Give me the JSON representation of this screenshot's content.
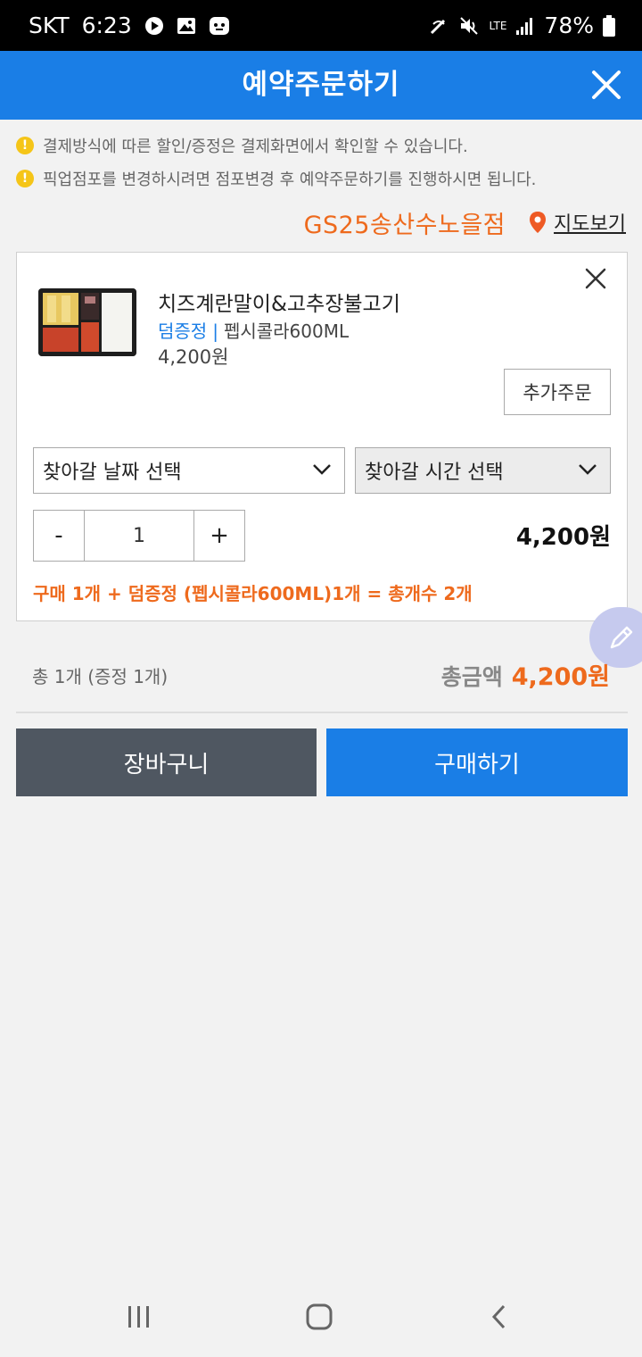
{
  "status_bar": {
    "carrier": "SKT",
    "time": "6:23",
    "network": "LTE",
    "battery": "78%",
    "icons": [
      "play-icon",
      "gallery-icon",
      "app-icon",
      "nfc-icon",
      "mute-icon",
      "signal-icon",
      "battery-icon"
    ]
  },
  "header": {
    "title": "예약주문하기",
    "close_icon": "close-icon"
  },
  "notices": [
    {
      "icon": "!",
      "text": "결제방식에 따른 할인/증정은 결제화면에서 확인할 수 있습니다."
    },
    {
      "icon": "!",
      "text": "픽업점포를 변경하시려면 점포변경 후 예약주문하기를 진행하시면 됩니다."
    }
  ],
  "store": {
    "name": "GS25송산수노을점",
    "map_link": "지도보기"
  },
  "item": {
    "name": "치즈계란말이&고추장불고기",
    "gift_tag": "덤증정",
    "gift_separator": "|",
    "gift_item": "펩시콜라600ML",
    "price": "4,200원",
    "add_order": "추가주문",
    "date_select": "찾아갈 날짜 선택",
    "time_select": "찾아갈 시간 선택",
    "minus": "-",
    "quantity": "1",
    "plus": "+",
    "line_total": "4,200원",
    "purchase_note": "구매 1개 + 덤증정 (펩시콜라600ML)1개 = 총개수 2개"
  },
  "summary": {
    "count_text": "총 1개 (증정 1개)",
    "total_label": "총금액",
    "total_amount": "4,200원"
  },
  "actions": {
    "cart": "장바구니",
    "buy": "구매하기"
  },
  "colors": {
    "primary": "#1a7ee6",
    "accent": "#ee6a1d",
    "dark_button": "#4f5761",
    "warning": "#f5c518"
  }
}
